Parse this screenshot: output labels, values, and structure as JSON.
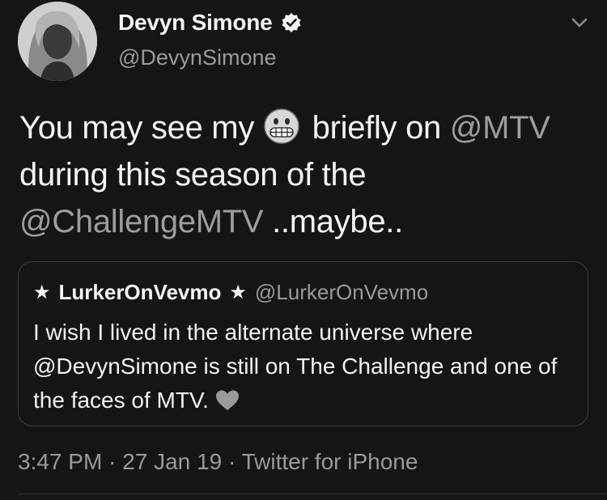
{
  "author": {
    "display_name": "Devyn Simone",
    "handle": "@DevynSimone",
    "verified": true,
    "avatar_icon": "profile-photo"
  },
  "menu": {
    "icon": "chevron-down-icon"
  },
  "tweet": {
    "segment_1": "You may see my ",
    "emoji": "grimacing-face",
    "segment_2": " briefly on ",
    "mention_1": "@MTV",
    "segment_3": " during this season of the ",
    "mention_2": "@ChallengeMTV",
    "segment_4": " ..maybe.."
  },
  "quoted_tweet": {
    "star_left": "★",
    "display_name": "LurkerOnVevmo",
    "star_right": "★",
    "handle": "@LurkerOnVevmo",
    "text": "I wish I lived in the alternate universe where @DevynSimone is still on The Challenge and one of the faces of MTV.",
    "emoji": "grey-heart"
  },
  "meta": {
    "time": "3:47 PM",
    "sep_1": " · ",
    "date": "27 Jan 19",
    "sep_2": " · ",
    "source": "Twitter for iPhone"
  },
  "colors": {
    "background": "#151515",
    "text": "#f4f4f4",
    "secondary": "#9a9a9a",
    "border": "#3d3d3d"
  }
}
